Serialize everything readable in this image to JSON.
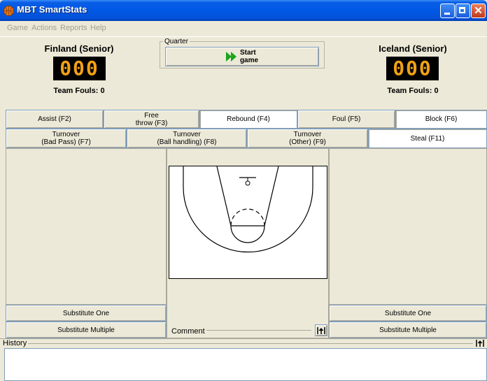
{
  "window": {
    "title": "MBT SmartStats",
    "close_glyph": "✕",
    "accent_color": "#0058e6"
  },
  "menu": {
    "items": [
      "Game",
      "Actions",
      "Reports",
      "Help"
    ]
  },
  "home_team": {
    "name": "Finland (Senior)",
    "score": "000",
    "fouls_label": "Team Fouls: 0"
  },
  "away_team": {
    "name": "Iceland (Senior)",
    "score": "000",
    "fouls_label": "Team Fouls: 0"
  },
  "quarter": {
    "legend": "Quarter",
    "start_line1": "Start",
    "start_line2": "game",
    "start_icon": "play-forward-icon"
  },
  "actions_row1": [
    {
      "label1": "Assist (F2)",
      "label2": ""
    },
    {
      "label1": "Free",
      "label2": "throw (F3)"
    },
    {
      "label1": "Rebound (F4)",
      "label2": ""
    },
    {
      "label1": "Foul (F5)",
      "label2": ""
    },
    {
      "label1": "Block (F6)",
      "label2": ""
    }
  ],
  "actions_row2": [
    {
      "label1": "Turnover",
      "label2": "(Bad Pass) (F7)"
    },
    {
      "label1": "Turnover",
      "label2": "(Ball handling) (F8)"
    },
    {
      "label1": "Turnover",
      "label2": "(Other) (F9)"
    },
    {
      "label1": "Steal (F11)",
      "label2": ""
    }
  ],
  "left_panel": {
    "substitute_one": "Substitute One",
    "substitute_multiple": "Substitute Multiple"
  },
  "right_panel": {
    "substitute_one": "Substitute One",
    "substitute_multiple": "Substitute Multiple"
  },
  "comment": {
    "label": "Comment",
    "button_icon": "expand-up-icon"
  },
  "history": {
    "label": "History",
    "button_icon": "expand-up-icon"
  }
}
